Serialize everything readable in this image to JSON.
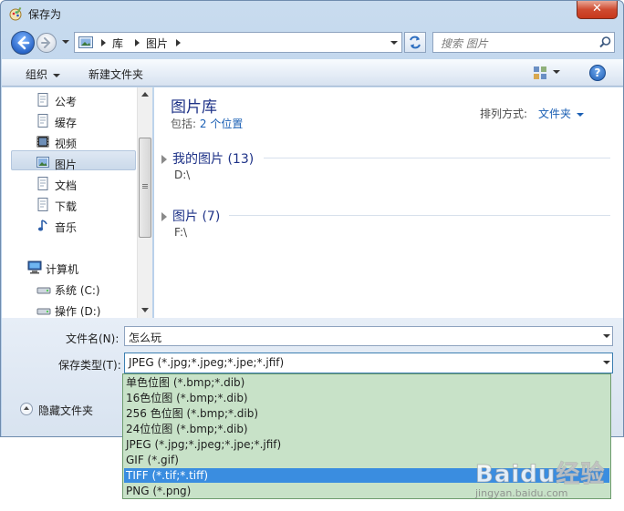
{
  "window": {
    "title": "保存为",
    "close_label": "✕"
  },
  "nav": {
    "breadcrumbs": [
      "库",
      "图片"
    ],
    "search_placeholder": "搜索 图片"
  },
  "toolbar": {
    "organize_label": "组织",
    "new_folder_label": "新建文件夹",
    "help_label": "?"
  },
  "sidebar": {
    "items": [
      {
        "label": "公考",
        "icon": "document-icon"
      },
      {
        "label": "缓存",
        "icon": "document-icon"
      },
      {
        "label": "视频",
        "icon": "video-icon"
      },
      {
        "label": "图片",
        "icon": "picture-icon",
        "selected": true
      },
      {
        "label": "文档",
        "icon": "document-icon"
      },
      {
        "label": "下载",
        "icon": "document-icon"
      },
      {
        "label": "音乐",
        "icon": "music-icon"
      },
      {
        "label": "计算机",
        "icon": "computer-icon"
      },
      {
        "label": "系统 (C:)",
        "icon": "drive-icon"
      },
      {
        "label": "操作 (D:)",
        "icon": "drive-icon"
      }
    ]
  },
  "library": {
    "title": "图片库",
    "includes_prefix": "包括:",
    "includes_link": "2 个位置",
    "arrange_label": "排列方式:",
    "arrange_value": "文件夹",
    "groups": [
      {
        "name": "我的图片 (13)",
        "path": "D:\\"
      },
      {
        "name": "图片 (7)",
        "path": "F:\\"
      }
    ]
  },
  "form": {
    "filename_label": "文件名(N):",
    "filename_value": "怎么玩",
    "filetype_label": "保存类型(T):",
    "filetype_value": "JPEG (*.jpg;*.jpeg;*.jpe;*.jfif)",
    "hide_folders_label": "隐藏文件夹"
  },
  "filetype_options": [
    "单色位图 (*.bmp;*.dib)",
    "16色位图 (*.bmp;*.dib)",
    "256 色位图 (*.bmp;*.dib)",
    "24位位图 (*.bmp;*.dib)",
    "JPEG (*.jpg;*.jpeg;*.jpe;*.jfif)",
    "GIF (*.gif)",
    "TIFF (*.tif;*.tiff)",
    "PNG (*.png)"
  ],
  "filetype_selected": "TIFF (*.tif;*.tiff)",
  "watermark": {
    "logo": "Baidu经验",
    "url": "jingyan.baidu.com"
  },
  "colors": {
    "accent": "#1e3287",
    "link": "#1a5fb4",
    "list_bg": "#c8e2c8",
    "list_selected": "#3a8de0"
  }
}
